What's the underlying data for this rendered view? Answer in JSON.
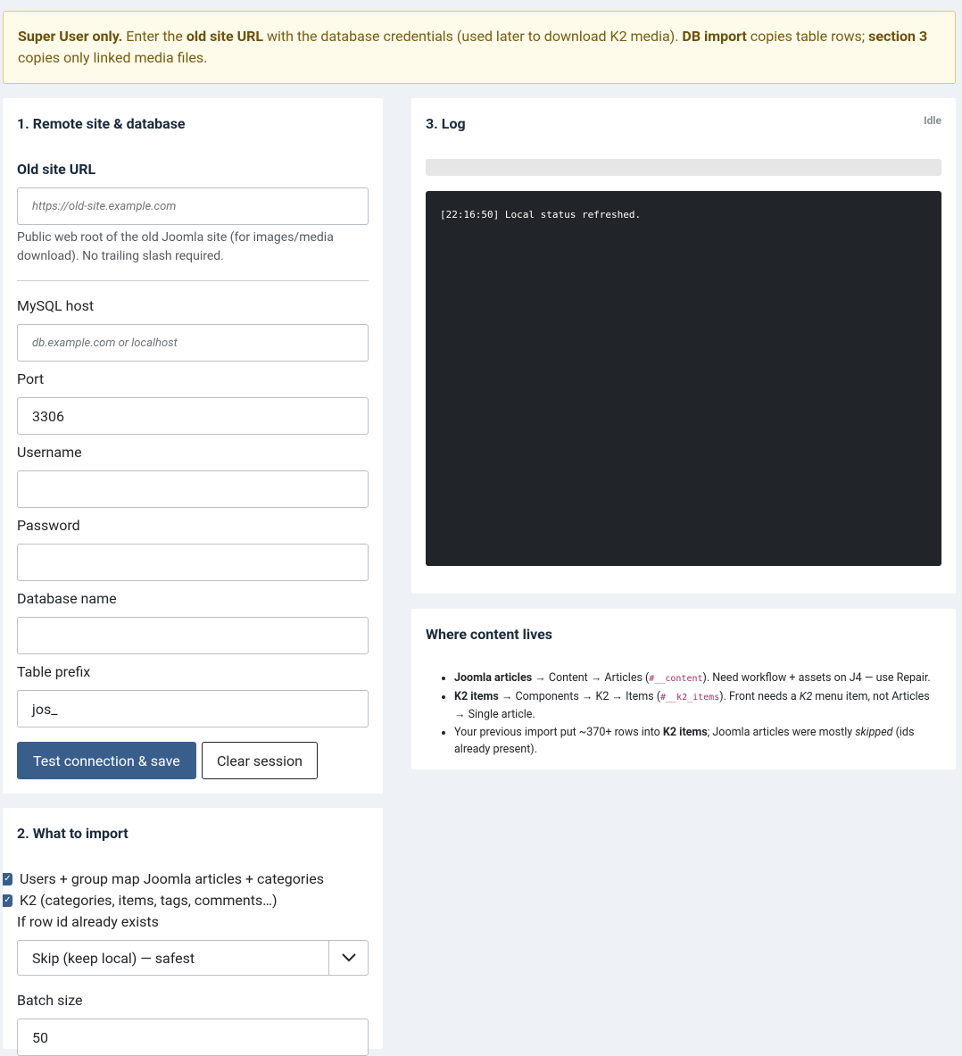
{
  "alert": {
    "super_user": "Super User only.",
    "t1": " Enter the ",
    "old_url": "old site URL",
    "t2": " with the database credentials (used later to download K2 media). ",
    "db_import": "DB import",
    "t3": " copies table rows; ",
    "section3": "section 3",
    "t4": " copies only linked media files."
  },
  "remote": {
    "title": "1. Remote site & database",
    "old_url_label": "Old site URL",
    "old_url_placeholder": "https://old-site.example.com",
    "old_url_help": "Public web root of the old Joomla site (for images/media download). No trailing slash required.",
    "host_label": "MySQL host",
    "host_placeholder": "db.example.com or localhost",
    "port_label": "Port",
    "port_value": "3306",
    "username_label": "Username",
    "username_value": "",
    "password_label": "Password",
    "password_value": "",
    "dbname_label": "Database name",
    "dbname_value": "",
    "prefix_label": "Table prefix",
    "prefix_value": "jos_",
    "test_button": "Test connection & save",
    "clear_button": "Clear session"
  },
  "what": {
    "title": "2. What to import",
    "check1": "Users + group map Joomla articles + categories",
    "check2": "K2 (categories, items, tags, comments…)",
    "exists_label": "If row id already exists",
    "exists_value": "Skip (keep local) — safest",
    "batch_label": "Batch size",
    "batch_value": "50"
  },
  "log": {
    "title": "3. Log",
    "status": "Idle",
    "line": "[22:16:50] Local status refreshed."
  },
  "where": {
    "title": "Where content lives",
    "li1_b": "Joomla articles",
    "li1_a": " → Content → Articles (",
    "li1_code": "#__content",
    "li1_c": "). Need workflow + assets on J4 — use Repair.",
    "li2_b": "K2 items",
    "li2_a": " → Components → K2 → Items (",
    "li2_code": "#__k2_items",
    "li2_c": "). Front needs a ",
    "li2_i": "K2",
    "li2_d": " menu item, not Articles → Single article.",
    "li3_a": "Your previous import put ~370+ rows into ",
    "li3_b": "K2 items",
    "li3_c": "; Joomla articles were mostly ",
    "li3_i": "skipped",
    "li3_d": " (ids already present)."
  }
}
